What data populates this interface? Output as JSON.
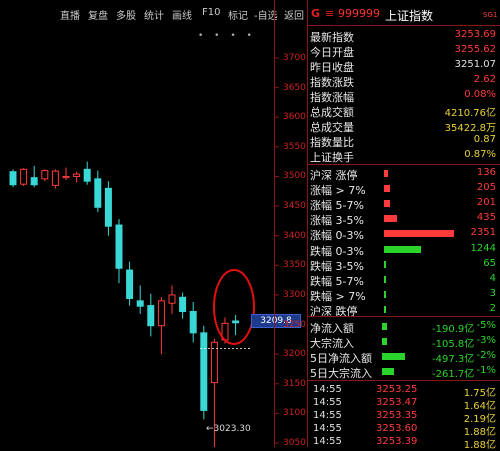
{
  "toolbar": [
    "直播",
    "复盘",
    "多股",
    "统计",
    "画线",
    "F10",
    "标记",
    "-自选",
    "返回"
  ],
  "header": {
    "g": "G",
    "eq": "≡",
    "code": "999999",
    "name": "上证指数",
    "tag": "SG1"
  },
  "chart": {
    "price_label": "3209.8",
    "low_label": "3023.30",
    "y_ticks": [
      "3700",
      "3650",
      "3600",
      "3550",
      "3500",
      "3450",
      "3400",
      "3350",
      "3300",
      "3250",
      "3200",
      "3150",
      "3100",
      "3050"
    ]
  },
  "quote": [
    {
      "label": "最新指数",
      "value": "3253.69",
      "color": "red"
    },
    {
      "label": "今日开盘",
      "value": "3255.62",
      "color": "red"
    },
    {
      "label": "昨日收盘",
      "value": "3251.07",
      "color": "white"
    },
    {
      "label": "指数涨跌",
      "value": "2.62",
      "color": "red"
    },
    {
      "label": "指数涨幅",
      "value": "0.08%",
      "color": "red"
    },
    {
      "label": "总成交额",
      "value": "4210.76亿",
      "color": "yellow"
    },
    {
      "label": "总成交量",
      "value": "35422.8万",
      "color": "yellow"
    },
    {
      "label": "指数量比",
      "value": "0.87",
      "color": "yellow"
    },
    {
      "label": "上证换手",
      "value": "0.87%",
      "color": "yellow"
    }
  ],
  "breadth_up": [
    {
      "label": "沪深 涨停",
      "count": "136",
      "bar": 0.06
    },
    {
      "label": "涨幅 > 7%",
      "count": "205",
      "bar": 0.09
    },
    {
      "label": "涨幅 5-7%",
      "count": "201",
      "bar": 0.09
    },
    {
      "label": "涨幅 3-5%",
      "count": "435",
      "bar": 0.19
    },
    {
      "label": "涨幅 0-3%",
      "count": "2351",
      "bar": 1.0
    }
  ],
  "breadth_down": [
    {
      "label": "跌幅 0-3%",
      "count": "1244",
      "bar": 0.53
    },
    {
      "label": "跌幅 3-5%",
      "count": "65",
      "bar": 0.03
    },
    {
      "label": "跌幅 5-7%",
      "count": "4",
      "bar": 0.01
    },
    {
      "label": "跌幅 > 7%",
      "count": "3",
      "bar": 0.01
    },
    {
      "label": "沪深 跌停",
      "count": "2",
      "bar": 0.01
    }
  ],
  "flows": [
    {
      "label": "净流入额",
      "amount": "-190.9亿",
      "pct": "-5%",
      "bar": 0.1
    },
    {
      "label": "大宗流入",
      "amount": "-105.8亿",
      "pct": "-3%",
      "bar": 0.1
    },
    {
      "label": "5日净流入额",
      "amount": "-497.3亿",
      "pct": "-2%",
      "bar": 0.5
    },
    {
      "label": "5日大宗流入",
      "amount": "-261.7亿",
      "pct": "-1%",
      "bar": 0.25
    }
  ],
  "ticks": [
    {
      "time": "14:55",
      "price": "3253.25",
      "vol": "1.75亿"
    },
    {
      "time": "14:55",
      "price": "3253.47",
      "vol": "1.64亿"
    },
    {
      "time": "14:55",
      "price": "3253.35",
      "vol": "2.19亿"
    },
    {
      "time": "14:55",
      "price": "3253.60",
      "vol": "1.88亿"
    },
    {
      "time": "14:55",
      "price": "3253.39",
      "vol": "1.88亿"
    }
  ],
  "colors": {
    "up": "#ff3b3b",
    "down": "#3ad7d7",
    "grid": "#8a1515",
    "accent": "#1d3a8c"
  },
  "candles_scale": {
    "min": 3000,
    "max": 3700
  },
  "candle_data": [
    {
      "o": 3508,
      "h": 3512,
      "l": 3482,
      "c": 3486
    },
    {
      "o": 3487,
      "h": 3514,
      "l": 3484,
      "c": 3512
    },
    {
      "o": 3498,
      "h": 3518,
      "l": 3482,
      "c": 3486
    },
    {
      "o": 3496,
      "h": 3512,
      "l": 3492,
      "c": 3510
    },
    {
      "o": 3485,
      "h": 3512,
      "l": 3480,
      "c": 3509
    },
    {
      "o": 3498,
      "h": 3515,
      "l": 3494,
      "c": 3500
    },
    {
      "o": 3500,
      "h": 3508,
      "l": 3490,
      "c": 3504
    },
    {
      "o": 3512,
      "h": 3525,
      "l": 3486,
      "c": 3492
    },
    {
      "o": 3496,
      "h": 3510,
      "l": 3440,
      "c": 3448
    },
    {
      "o": 3480,
      "h": 3492,
      "l": 3400,
      "c": 3416
    },
    {
      "o": 3418,
      "h": 3428,
      "l": 3320,
      "c": 3345
    },
    {
      "o": 3342,
      "h": 3356,
      "l": 3282,
      "c": 3294
    },
    {
      "o": 3290,
      "h": 3316,
      "l": 3268,
      "c": 3281
    },
    {
      "o": 3282,
      "h": 3302,
      "l": 3230,
      "c": 3248
    },
    {
      "o": 3248,
      "h": 3296,
      "l": 3200,
      "c": 3290
    },
    {
      "o": 3286,
      "h": 3316,
      "l": 3268,
      "c": 3300
    },
    {
      "o": 3296,
      "h": 3304,
      "l": 3260,
      "c": 3272
    },
    {
      "o": 3272,
      "h": 3288,
      "l": 3220,
      "c": 3236
    },
    {
      "o": 3236,
      "h": 3248,
      "l": 3090,
      "c": 3105
    },
    {
      "o": 3152,
      "h": 3226,
      "l": 3023,
      "c": 3220
    },
    {
      "o": 3224,
      "h": 3262,
      "l": 3218,
      "c": 3252
    },
    {
      "o": 3256,
      "h": 3266,
      "l": 3232,
      "c": 3253
    }
  ]
}
